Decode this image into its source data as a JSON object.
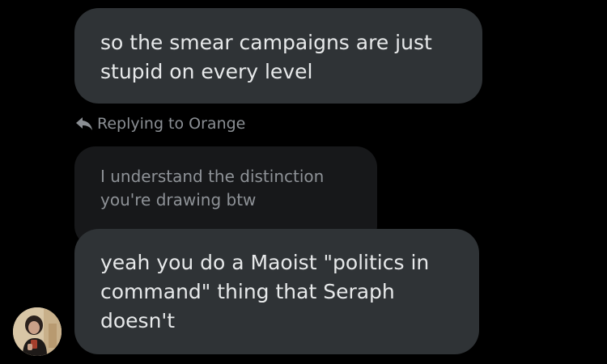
{
  "thread": {
    "message_1": {
      "text": "so the smear campaigns are just\nstupid on every level"
    },
    "reply_indicator": {
      "icon": "reply-arrow-icon",
      "label": "Replying to Orange"
    },
    "quoted_message": {
      "text": "I understand the distinction\nyou're drawing btw"
    },
    "message_2": {
      "text": "yeah you do a Maoist \"politics in\ncommand\" thing that Seraph\ndoesn't"
    },
    "avatar": {
      "icon": "user-avatar-photo"
    }
  },
  "colors": {
    "background": "#000000",
    "bubble": "#2f3336",
    "quoted_bubble": "#17181a",
    "primary_text": "#e7e9ea",
    "muted_text": "#8e9297"
  }
}
